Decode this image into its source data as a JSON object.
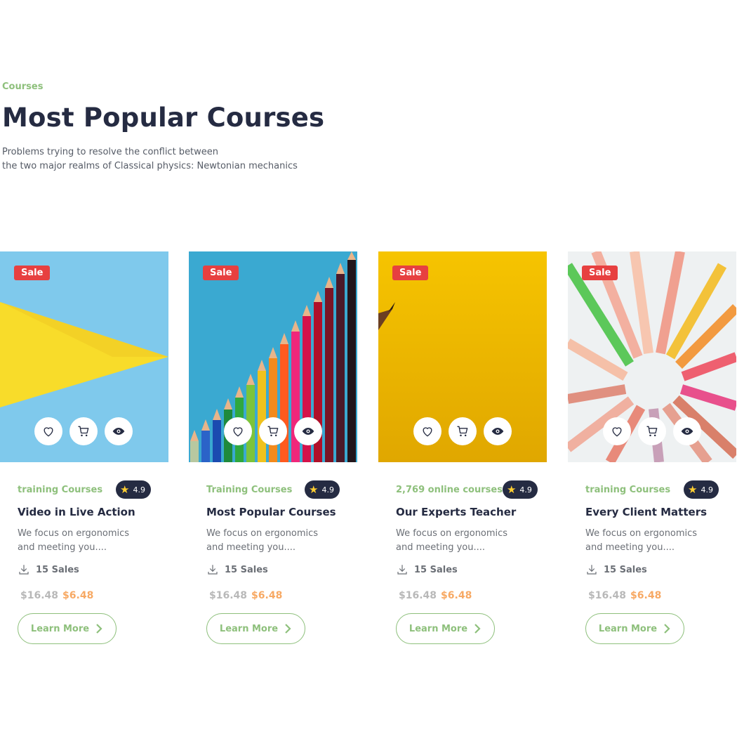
{
  "header": {
    "eyebrow": "Courses",
    "title": "Most Popular Courses",
    "subtitle_line1": "Problems trying to resolve the conflict between",
    "subtitle_line2": "the two major realms of Classical physics: Newtonian mechanics"
  },
  "colors": {
    "accent_green": "#8ec07c",
    "heading": "#252b42",
    "sale_red": "#e74040",
    "price_orange": "#f7a964",
    "star": "#ffce31"
  },
  "icons": [
    "heart-icon",
    "cart-icon",
    "eye-icon",
    "star-icon",
    "download-icon",
    "chevron-right-icon"
  ],
  "courses": [
    {
      "badge": "Sale",
      "image": "blue-yellow-geometric",
      "category": "training Courses",
      "rating": "4.9",
      "title": "Video in Live Action",
      "desc_line1": "We focus on ergonomics",
      "desc_line2": "and meeting you....",
      "sales": "15 Sales",
      "old_price": "$16.48",
      "new_price": "$6.48",
      "cta": "Learn More"
    },
    {
      "badge": "Sale",
      "image": "colored-pencils-on-blue",
      "category": "Training Courses",
      "rating": "4.9",
      "title": "Most Popular Courses",
      "desc_line1": "We focus on ergonomics",
      "desc_line2": "and meeting you....",
      "sales": "15 Sales",
      "old_price": "$16.48",
      "new_price": "$6.48",
      "cta": "Learn More"
    },
    {
      "badge": "Sale",
      "image": "pencil-on-yellow",
      "category": "2,769 online courses",
      "rating": "4.9",
      "title": "Our Experts Teacher",
      "desc_line1": "We focus on ergonomics",
      "desc_line2": "and meeting you....",
      "sales": "15 Sales",
      "old_price": "$16.48",
      "new_price": "$6.48",
      "cta": "Learn More"
    },
    {
      "badge": "Sale",
      "image": "pencils-circle",
      "category": "training Courses",
      "rating": "4.9",
      "title": "Every Client Matters",
      "desc_line1": "We focus on ergonomics",
      "desc_line2": "and meeting you....",
      "sales": "15 Sales",
      "old_price": "$16.48",
      "new_price": "$6.48",
      "cta": "Learn More"
    }
  ]
}
